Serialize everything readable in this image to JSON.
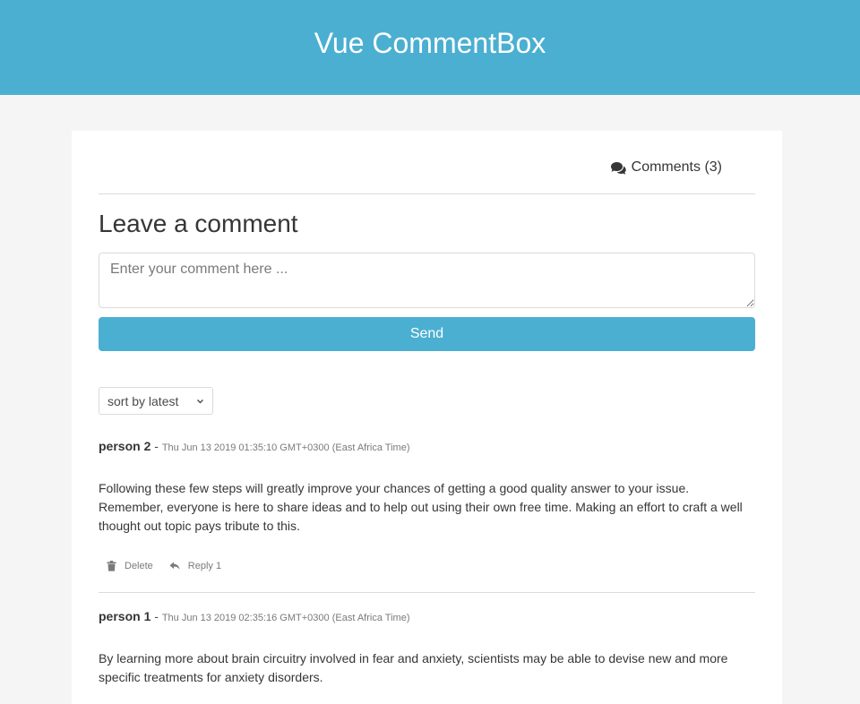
{
  "header": {
    "title": "Vue CommentBox"
  },
  "tabs": {
    "comments_label": "Comments (3)"
  },
  "form": {
    "heading": "Leave a comment",
    "placeholder": "Enter your comment here ...",
    "send_label": "Send"
  },
  "sort": {
    "selected": "sort by latest"
  },
  "comments": [
    {
      "author": "person 2",
      "separator": "-",
      "date": "Thu Jun 13 2019 01:35:10 GMT+0300 (East Africa Time)",
      "body": "Following these few steps will greatly improve your chances of getting a good quality answer to your issue. Remember, everyone is here to share ideas and to help out using their own free time. Making an effort to craft a well thought out topic pays tribute to this.",
      "delete_label": "Delete",
      "reply_label": "Reply 1"
    },
    {
      "author": "person 1",
      "separator": "-",
      "date": "Thu Jun 13 2019 02:35:16 GMT+0300 (East Africa Time)",
      "body": "By learning more about brain circuitry involved in fear and anxiety, scientists may be able to devise new and more specific treatments for anxiety disorders."
    }
  ],
  "icons": {
    "comments": "comments-icon",
    "sort": "chevron-down-icon",
    "delete": "trash-icon",
    "reply": "reply-icon"
  },
  "colors": {
    "primary": "#4bafd1",
    "background": "#f5f5f5",
    "text": "#363636"
  }
}
